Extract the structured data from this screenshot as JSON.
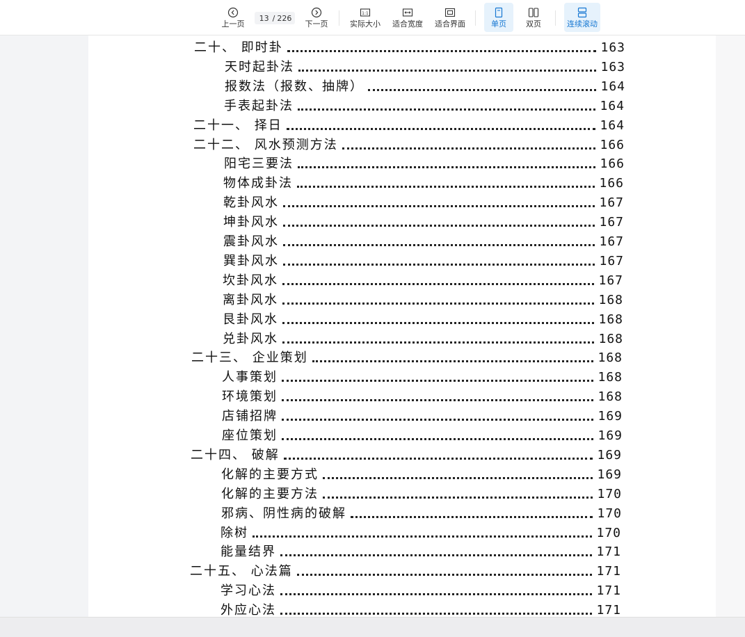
{
  "toolbar": {
    "prev_label": "上一页",
    "next_label": "下一页",
    "current_page": "13",
    "page_separator": "/",
    "total_pages": "226",
    "actual_size_label": "实际大小",
    "fit_width_label": "适合宽度",
    "fit_page_label": "适合界面",
    "single_page_label": "单页",
    "double_page_label": "双页",
    "continuous_label": "连续滚动",
    "accent_color": "#1677d2"
  },
  "toc": [
    {
      "title": "二十、 即时卦",
      "page": "163",
      "level": 1
    },
    {
      "title": "天时起卦法",
      "page": "163",
      "level": 2
    },
    {
      "title": "报数法（报数、抽牌）",
      "page": "164",
      "level": 2
    },
    {
      "title": "手表起卦法",
      "page": "164",
      "level": 2
    },
    {
      "title": "二十一、 择日",
      "page": "164",
      "level": 1
    },
    {
      "title": "二十二、 风水预测方法",
      "page": "166",
      "level": 1
    },
    {
      "title": "阳宅三要法",
      "page": "166",
      "level": 2
    },
    {
      "title": "物体成卦法",
      "page": "166",
      "level": 2
    },
    {
      "title": "乾卦风水",
      "page": "167",
      "level": 2
    },
    {
      "title": "坤卦风水",
      "page": "167",
      "level": 2
    },
    {
      "title": "震卦风水",
      "page": "167",
      "level": 2
    },
    {
      "title": "巽卦风水",
      "page": "167",
      "level": 2
    },
    {
      "title": "坎卦风水",
      "page": "167",
      "level": 2
    },
    {
      "title": "离卦风水",
      "page": "168",
      "level": 2
    },
    {
      "title": "艮卦风水",
      "page": "168",
      "level": 2
    },
    {
      "title": "兑卦风水",
      "page": "168",
      "level": 2
    },
    {
      "title": "二十三、 企业策划",
      "page": "168",
      "level": 1
    },
    {
      "title": "人事策划",
      "page": "168",
      "level": 2
    },
    {
      "title": "环境策划",
      "page": "168",
      "level": 2
    },
    {
      "title": "店铺招牌",
      "page": "169",
      "level": 2
    },
    {
      "title": "座位策划",
      "page": "169",
      "level": 2
    },
    {
      "title": "二十四、 破解",
      "page": "169",
      "level": 1
    },
    {
      "title": "化解的主要方式",
      "page": "169",
      "level": 2
    },
    {
      "title": "化解的主要方法",
      "page": "170",
      "level": 2
    },
    {
      "title": "邪病、阴性病的破解",
      "page": "170",
      "level": 2
    },
    {
      "title": "除树",
      "page": "170",
      "level": 2
    },
    {
      "title": "能量结界",
      "page": "171",
      "level": 2
    },
    {
      "title": "二十五、 心法篇",
      "page": "171",
      "level": 1
    },
    {
      "title": "学习心法",
      "page": "171",
      "level": 2
    },
    {
      "title": "外应心法",
      "page": "171",
      "level": 2
    }
  ]
}
